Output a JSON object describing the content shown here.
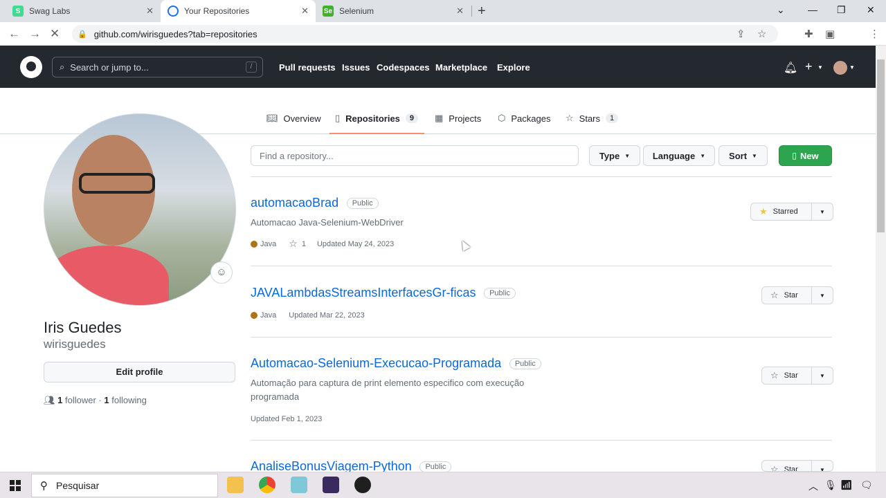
{
  "browser": {
    "tabs": [
      {
        "title": "Swag Labs",
        "active": false
      },
      {
        "title": "Your Repositories",
        "active": true
      },
      {
        "title": "Selenium",
        "active": false
      }
    ],
    "url": "github.com/wirisguedes?tab=repositories"
  },
  "header": {
    "search_placeholder": "Search or jump to...",
    "search_shortcut": "/",
    "nav": [
      "Pull requests",
      "Issues",
      "Codespaces",
      "Marketplace",
      "Explore"
    ]
  },
  "profile_nav": {
    "overview": "Overview",
    "repositories": "Repositories",
    "repositories_count": "9",
    "projects": "Projects",
    "packages": "Packages",
    "stars": "Stars",
    "stars_count": "1"
  },
  "profile": {
    "fullname": "Iris Guedes",
    "username": "wirisguedes",
    "edit_label": "Edit profile",
    "followers_count": "1",
    "followers_label": "follower",
    "separator": "·",
    "following_count": "1",
    "following_label": "following"
  },
  "filters": {
    "find_placeholder": "Find a repository...",
    "type_label": "Type",
    "language_label": "Language",
    "sort_label": "Sort",
    "new_label": "New"
  },
  "repos": [
    {
      "name": "automacaoBrad",
      "visibility": "Public",
      "description": "Automacao Java-Selenium-WebDriver",
      "language": "Java",
      "stars": "1",
      "updated": "Updated May 24, 2023",
      "star_label": "Starred"
    },
    {
      "name": "JAVALambdasStreamsInterfacesGr-ficas",
      "visibility": "Public",
      "language": "Java",
      "updated": "Updated Mar 22, 2023",
      "star_label": "Star"
    },
    {
      "name": "Automacao-Selenium-Execucao-Programada",
      "visibility": "Public",
      "description": "Automação para captura de print elemento especifico com execução programada",
      "updated": "Updated Feb 1, 2023",
      "star_label": "Star"
    },
    {
      "name": "AnaliseBonusViagem-Python",
      "visibility": "Public",
      "star_label": "Star"
    }
  ],
  "taskbar": {
    "search_label": "Pesquisar"
  },
  "colors": {
    "header_bg": "#24292f",
    "link": "#0969da",
    "new_button": "#2da44e",
    "tab_underline": "#fd8c73",
    "java_dot": "#b07219"
  }
}
